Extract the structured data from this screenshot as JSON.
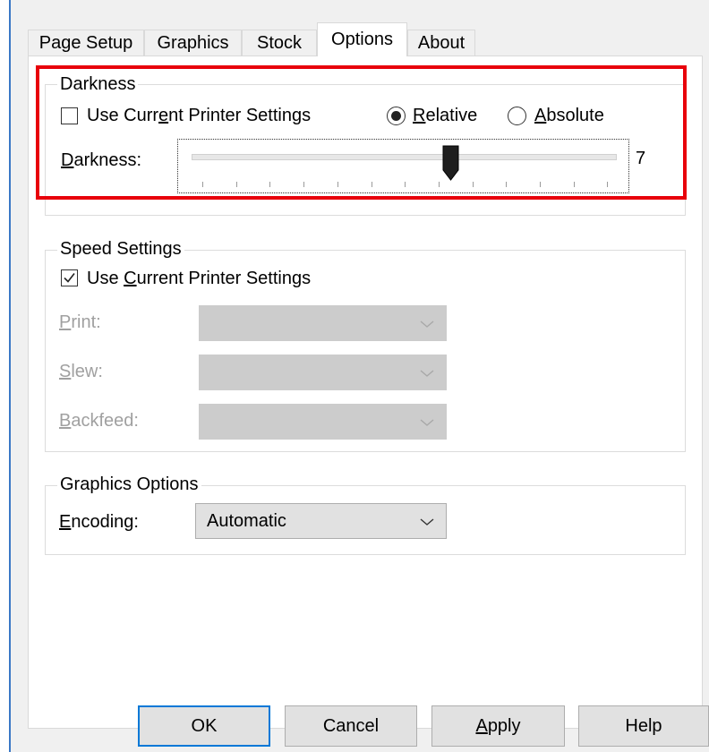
{
  "tabs": [
    {
      "label": "Page Setup",
      "active": false
    },
    {
      "label": "Graphics",
      "active": false
    },
    {
      "label": "Stock",
      "active": false
    },
    {
      "label": "Options",
      "active": true
    },
    {
      "label": "About",
      "active": false
    }
  ],
  "darkness": {
    "group_title": "Darkness",
    "use_current_label_pre": "Use Curr",
    "use_current_label_u": "e",
    "use_current_label_post": "nt Printer Settings",
    "use_current_checked": false,
    "relative_u": "R",
    "relative_rest": "elative",
    "relative_selected": true,
    "absolute_u": "A",
    "absolute_rest": "bsolute",
    "slider_label_u": "D",
    "slider_label_rest": "arkness:",
    "slider_value": "7",
    "highlight_color": "#e8000b"
  },
  "speed": {
    "group_title": "Speed Settings",
    "use_current_label_pre": "Use ",
    "use_current_label_u": "C",
    "use_current_label_post": "urrent Printer Settings",
    "use_current_checked": true,
    "print_u": "P",
    "print_rest": "rint:",
    "slew_u": "S",
    "slew_rest": "lew:",
    "backfeed_u": "B",
    "backfeed_rest": "ackfeed:"
  },
  "graphics_options": {
    "group_title": "Graphics Options",
    "encoding_u": "E",
    "encoding_rest": "ncoding:",
    "encoding_value": "Automatic"
  },
  "buttons": {
    "ok": "OK",
    "cancel": "Cancel",
    "apply_u": "A",
    "apply_rest": "pply",
    "help": "Help"
  }
}
